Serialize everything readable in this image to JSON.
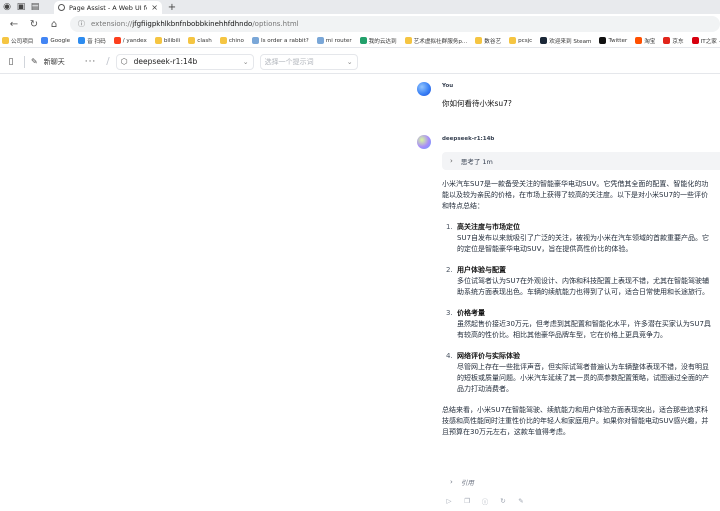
{
  "browser": {
    "tab_title": "Page Assist - A Web UI for Local AI",
    "new_tab_symbol": "+",
    "url": {
      "scheme": "extension://",
      "host": "jfgfiigpkhlkbnfnbobbkinehhfdhndo",
      "path": "/options.html"
    }
  },
  "bookmarks": [
    {
      "label": "公司项目",
      "color": "#f5c542"
    },
    {
      "label": "Google",
      "color": "#4285f4"
    },
    {
      "label": "音 扫码",
      "color": "#2d8cf0"
    },
    {
      "label": "/ yandex",
      "color": "#fc3f1d"
    },
    {
      "label": "bilibili",
      "color": "#f5c542"
    },
    {
      "label": "clash",
      "color": "#f5c542"
    },
    {
      "label": "chino",
      "color": "#f5c542"
    },
    {
      "label": "Is order a rabbit?",
      "color": "#7aa7d8"
    },
    {
      "label": "mi router",
      "color": "#7aa7d8"
    },
    {
      "label": "我的云达到",
      "color": "#22a06b"
    },
    {
      "label": "艺术虚拟社群服务p...",
      "color": "#f5c542"
    },
    {
      "label": "数谷艺",
      "color": "#f5c542"
    },
    {
      "label": "pcsjc",
      "color": "#f5c542"
    },
    {
      "label": "欢迎来到 Steam",
      "color": "#1b2838"
    },
    {
      "label": "Twitter",
      "color": "#111111"
    },
    {
      "label": "淘宝",
      "color": "#ff5000"
    },
    {
      "label": "京东",
      "color": "#e1251b"
    },
    {
      "label": "IT之家 · 数码",
      "color": "#d7000f"
    }
  ],
  "header": {
    "new_chat_label": "新聊天",
    "more_symbol": "···",
    "model_value": "deepseek-r1:14b",
    "prompt_placeholder": "选择一个提示词"
  },
  "chat": {
    "user_name": "You",
    "user_message": "你如何看待小米su7?",
    "bot_name": "deepseek-r1:14b",
    "thinking_label": "思考了 1m",
    "intro": "小米汽车SU7是一款备受关注的智能豪华电动SUV。它凭借其全面的配置、智能化的功能以及较为亲民的价格，在市场上获得了较高的关注度。以下是对小米SU7的一些评价和特点总结：",
    "points": [
      {
        "num": "1.",
        "title": "高关注度与市场定位",
        "text": "SU7自发布以来就吸引了广泛的关注，被视为小米在汽车领域的首款重要产品。它的定位是智能豪华电动SUV，旨在提供高性价比的体验。"
      },
      {
        "num": "2.",
        "title": "用户体验与配置",
        "text": "多位试驾者认为SU7在外观设计、内饰和科技配置上表现不错，尤其在智能驾驶辅助系统方面表现出色。车辆的续航能力也得到了认可，适合日常使用和长途旅行。"
      },
      {
        "num": "3.",
        "title": "价格考量",
        "text": "虽然起售价接近30万元，但考虑到其配置和智能化水平，许多潜在买家认为SU7具有较高的性价比。相比其他豪华品牌车型，它在价格上更具竞争力。"
      },
      {
        "num": "4.",
        "title": "网络评价与实际体验",
        "text": "尽管网上存在一些批评声音，但实际试驾者普遍认为车辆整体表现不错，没有明显的短板或质量问题。小米汽车延续了其一贯的高参数配置策略，试图通过全面的产品力打动消费者。"
      }
    ],
    "summary": "总结来看，小米SU7在智能驾驶、续航能力和用户体验方面表现突出，适合那些追求科技感和高性能同时注重性价比的年轻人和家庭用户。如果你对智能电动SUV感兴趣，并且预算在30万元左右，这款车值得考虑。",
    "citations_label": "引用"
  }
}
